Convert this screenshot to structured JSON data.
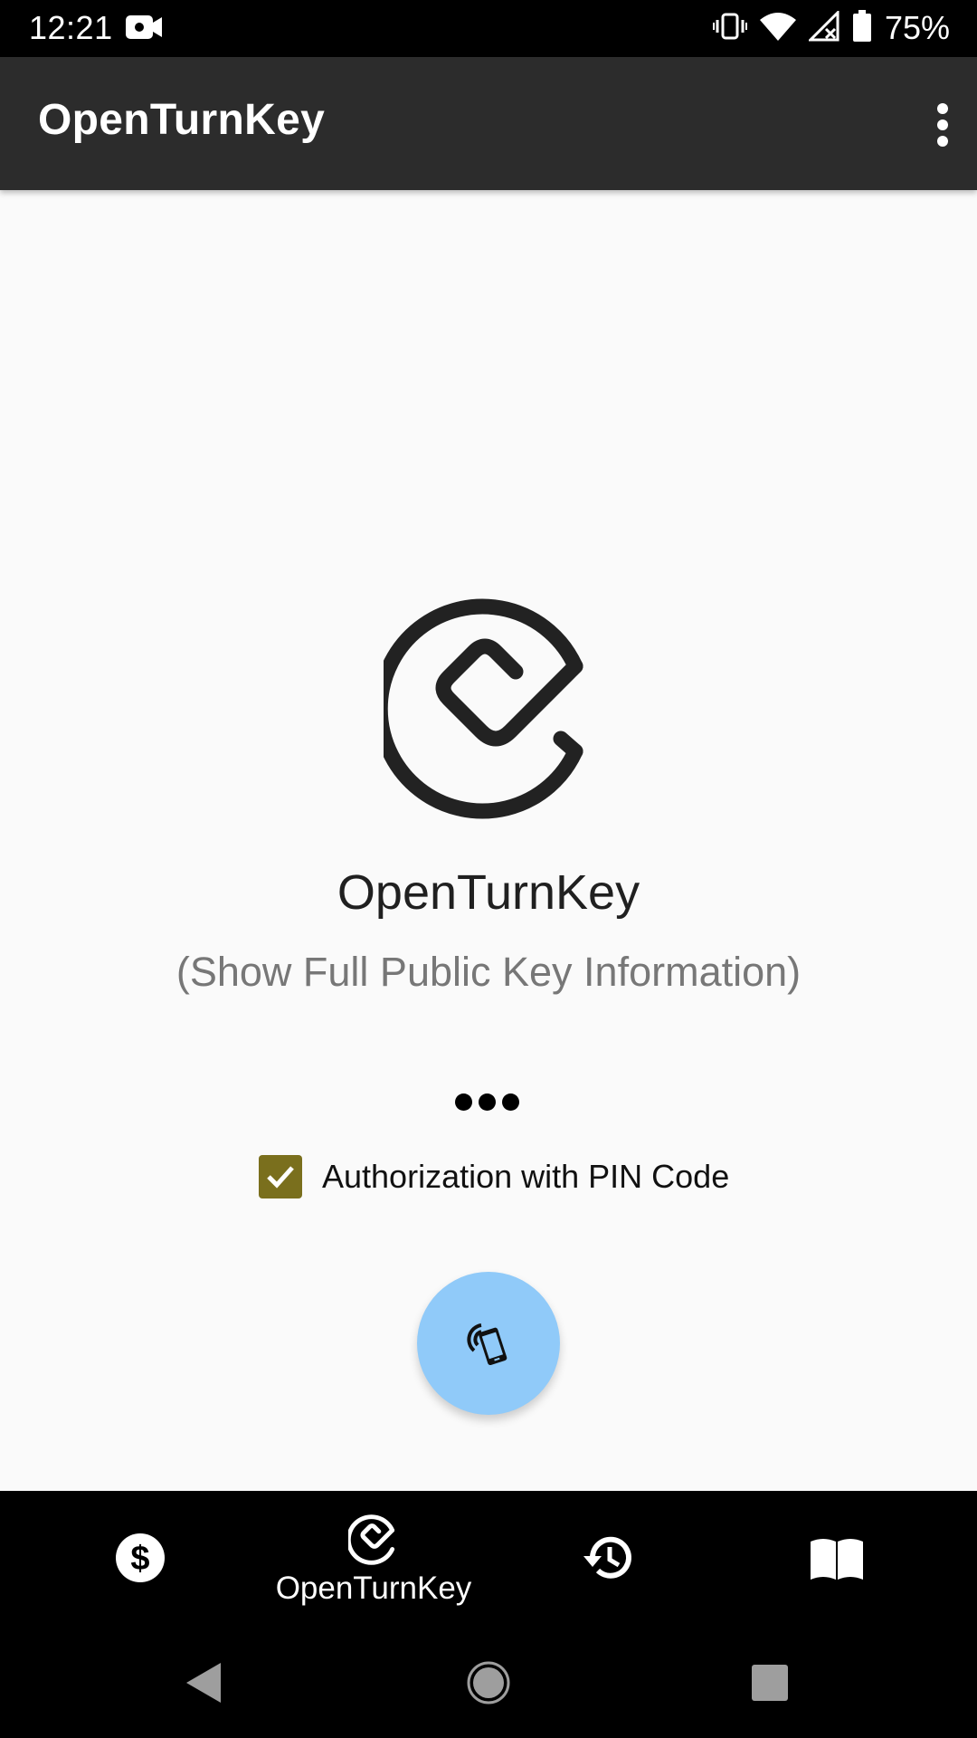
{
  "status_bar": {
    "time": "12:21",
    "battery_percent": "75%",
    "icons": [
      "video-camera-icon",
      "vibrate-icon",
      "wifi-icon",
      "signal-off-icon",
      "battery-icon"
    ]
  },
  "app_bar": {
    "title": "OpenTurnKey",
    "overflow_icon": "more-vert-icon"
  },
  "main": {
    "logo_icon": "openturnkey-logo-icon",
    "app_name": "OpenTurnKey",
    "public_key_link": "(Show Full Public Key Information)",
    "pin_checkbox": {
      "label": "Authorization with PIN Code",
      "checked": true
    },
    "nfc_button_icon": "nfc-phone-icon"
  },
  "bottom_nav": {
    "items": [
      {
        "icon": "dollar-icon",
        "label": "",
        "selected": false
      },
      {
        "icon": "openturnkey-icon",
        "label": "OpenTurnKey",
        "selected": true
      },
      {
        "icon": "history-icon",
        "label": "",
        "selected": false
      },
      {
        "icon": "book-icon",
        "label": "",
        "selected": false
      }
    ]
  },
  "system_nav": [
    "back-icon",
    "home-icon",
    "recents-icon"
  ],
  "colors": {
    "app_bar": "#2c2c2c",
    "checkbox": "#7a6f1d",
    "fab": "#90caf9",
    "background": "#fafafa"
  }
}
